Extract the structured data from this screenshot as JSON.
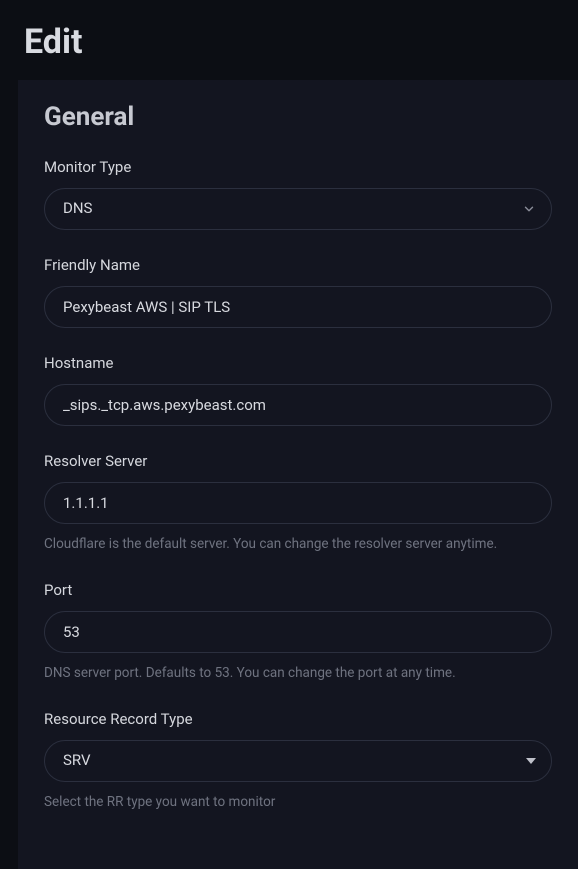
{
  "page": {
    "title": "Edit"
  },
  "general": {
    "section_title": "General",
    "monitor_type": {
      "label": "Monitor Type",
      "value": "DNS"
    },
    "friendly_name": {
      "label": "Friendly Name",
      "value": "Pexybeast AWS | SIP TLS"
    },
    "hostname": {
      "label": "Hostname",
      "value": "_sips._tcp.aws.pexybeast.com"
    },
    "resolver_server": {
      "label": "Resolver Server",
      "value": "1.1.1.1",
      "helper": "Cloudflare is the default server. You can change the resolver server anytime."
    },
    "port": {
      "label": "Port",
      "value": "53",
      "helper": "DNS server port. Defaults to 53. You can change the port at any time."
    },
    "rr_type": {
      "label": "Resource Record Type",
      "value": "SRV",
      "helper": "Select the RR type you want to monitor"
    }
  }
}
